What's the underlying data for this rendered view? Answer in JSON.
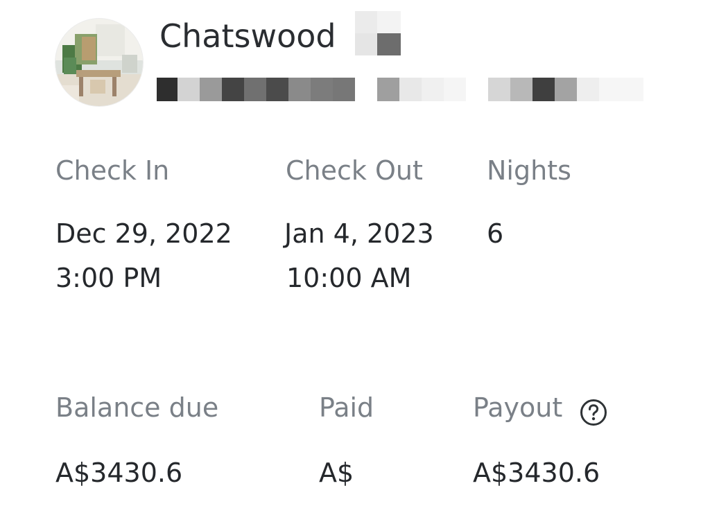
{
  "header": {
    "property_name": "Chatswood"
  },
  "stay": {
    "check_in_label": "Check In",
    "check_out_label": "Check Out",
    "nights_label": "Nights",
    "check_in_date": "Dec 29, 2022",
    "check_in_time": "3:00 PM",
    "check_out_date": "Jan 4, 2023",
    "check_out_time": "10:00 AM",
    "nights": "6"
  },
  "payment": {
    "balance_due_label": "Balance due",
    "paid_label": "Paid",
    "payout_label": "Payout",
    "balance_due": "A$3430.6",
    "paid": "A$",
    "payout": "A$3430.6",
    "help_icon": "question-circle-icon"
  }
}
